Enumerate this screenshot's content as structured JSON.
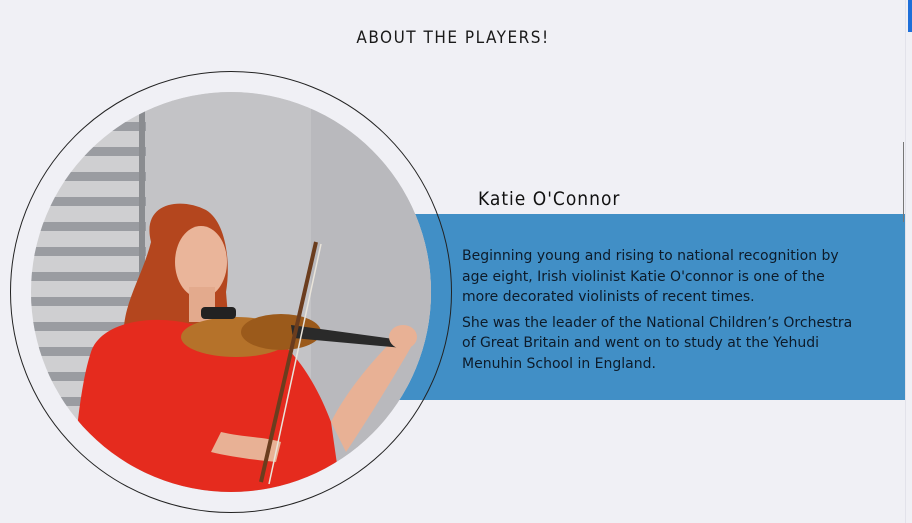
{
  "section": {
    "title": "ABOUT THE PLAYERS!"
  },
  "player": {
    "name": "Katie O'Connor",
    "bio": [
      "Beginning young and rising to national recognition by age eight, Irish violinist Katie O'connor is one of the more decorated violinists of recent times.",
      "She was the leader of the National Children’s Orchestra of Great Britain and went on to study at the Yehudi Menuhin School in England."
    ],
    "photo_icon": "violinist-photo"
  },
  "colors": {
    "background": "#f0f0f5",
    "panel": "#418fc6",
    "scroll_accent": "#1e6fd9"
  }
}
